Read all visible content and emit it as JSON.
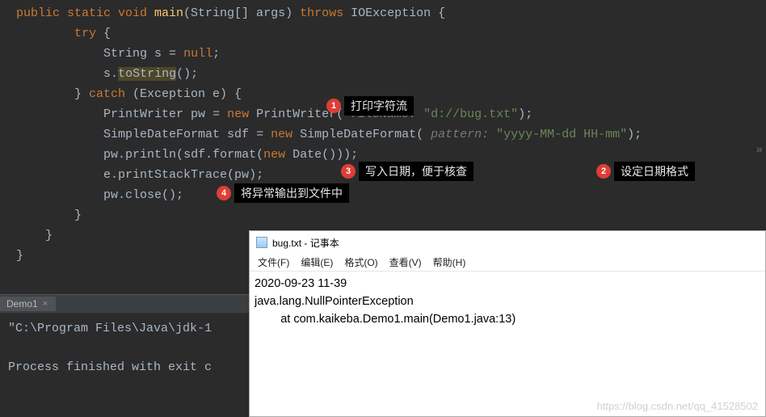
{
  "code": {
    "l1": "    public static void main(String[] args) throws IOException {",
    "l2": "        try {",
    "l3a": "            String ",
    "l3b": "s",
    "l3c": " = ",
    "l3d": "null",
    "l3e": ";",
    "l4a": "            ",
    "l4b": "s",
    "l4c": ".",
    "l4d": "toString",
    "l4e": "();",
    "l5": "        } catch (Exception e) {",
    "l6a": "            PrintWriter ",
    "l6b": "pw",
    "l6c": " = ",
    "l6d": "new ",
    "l6e": "PrintWriter(",
    "l6f": " fileName: ",
    "l6g": "\"d://bug.txt\"",
    "l6h": ");",
    "l7a": "            SimpleDateFormat ",
    "l7b": "sdf",
    "l7c": " = ",
    "l7d": "new ",
    "l7e": "SimpleDateFormat(",
    "l7f": " pattern: ",
    "l7g": "\"yyyy-MM-dd HH-mm\"",
    "l7h": ");",
    "l8a": "            ",
    "l8b": "pw",
    "l8c": ".println(",
    "l8d": "sdf",
    "l8e": ".format(",
    "l8f": "new ",
    "l8g": "Date()));",
    "l9": "            e.printStackTrace(pw);",
    "l10a": "            ",
    "l10b": "pw",
    "l10c": ".close();",
    "l11": "        }",
    "l12": "    }",
    "l13": "}"
  },
  "annot": {
    "n1": "1",
    "t1": "打印字符流",
    "n2": "2",
    "t2": "设定日期格式",
    "n3": "3",
    "t3": "写入日期，便于核查",
    "n4": "4",
    "t4": "将异常输出到文件中"
  },
  "tab": {
    "name": "Demo1",
    "close": "×"
  },
  "console": {
    "l1": "\"C:\\Program Files\\Java\\jdk-1",
    "l2": "Process finished with exit c"
  },
  "notepad": {
    "title": "bug.txt - 记事本",
    "menu": [
      "文件(F)",
      "编辑(E)",
      "格式(O)",
      "查看(V)",
      "帮助(H)"
    ],
    "body": "2020-09-23 11-39\njava.lang.NullPointerException\n\tat com.kaikeba.Demo1.main(Demo1.java:13)"
  },
  "watermark": "https://blog.csdn.net/qq_41528502"
}
